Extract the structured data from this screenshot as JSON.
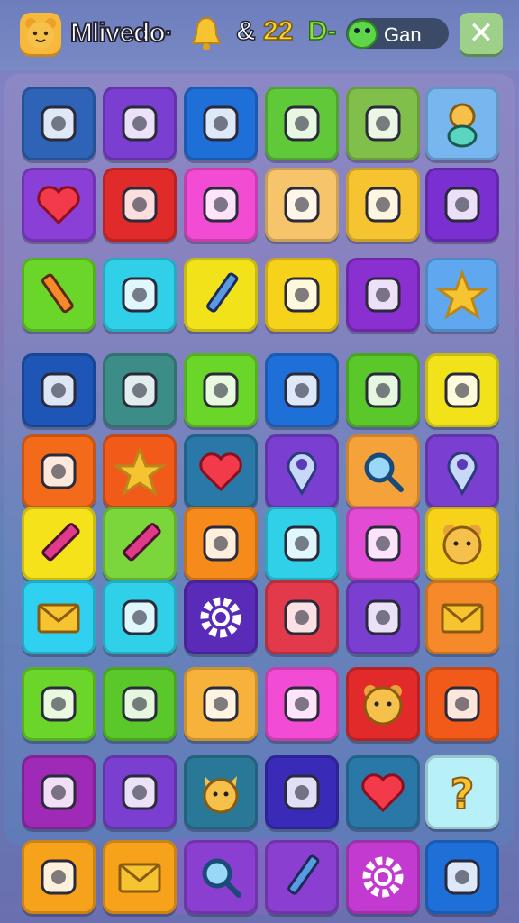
{
  "header": {
    "title": "Mlivedo·",
    "score_prefix": "&",
    "score_value": "22",
    "score_suffix": "D-",
    "player_label": "Gan",
    "close_label": "✕"
  },
  "colors": {
    "topbar": "#7484c2",
    "pill": "#3b4a66",
    "close_button": "#9ed08a"
  },
  "grid": {
    "rows": [
      [
        "portfolio-icon",
        "candy-stick-icon",
        "eye-icon",
        "chain-link-icon",
        "lipstick-icon",
        "teddy-bear-icon"
      ],
      [
        "heart-icon",
        "ice-pop-icon",
        "lollipop-icon",
        "ring-key-icon",
        "speech-bubble-icon",
        "dial-icon"
      ],
      [
        "pencil-icon",
        "tablet-icon",
        "pen-icon",
        "robot-toy-icon",
        "jar-icon",
        "star-icon"
      ],
      [
        "notepad-icon",
        "plane-icon",
        "dice-icon",
        "ice-cream-icon",
        "leaf-badge-icon",
        "balloon-face-icon"
      ],
      [
        "key-ring-icon",
        "star-icon",
        "heart-icon",
        "location-pin-icon",
        "magnifier-icon",
        "location-pin-icon"
      ],
      [
        "crayon-icon",
        "crayon-icon",
        "cone-icon",
        "ticket-icon",
        "leaf-icon",
        "bear-face-icon"
      ],
      [
        "envelope-icon",
        "lollipop-icon",
        "gear-icon",
        "shopping-bag-icon",
        "creature-icon",
        "envelope-icon"
      ],
      [
        "brush-icon",
        "balloon-icon",
        "hammer-icon",
        "spoon-icon",
        "bear-face-icon",
        "phone-icon"
      ],
      [
        "whistle-icon",
        "pinwheel-icon",
        "cat-face-icon",
        "eraser-icon",
        "heart-icon",
        "question-mark-icon"
      ],
      [
        "box-icon",
        "envelope-icon",
        "magnifier-icon",
        "pen-icon",
        "gear-icon",
        "sparkle-icon"
      ]
    ],
    "tile_colors": [
      [
        "#2e63b8",
        "#7a3fd0",
        "#1e6fd8",
        "#5fc93a",
        "#7fbf4a",
        "#78b6f0"
      ],
      [
        "#8a3fd6",
        "#e12a2a",
        "#f24bd4",
        "#f6c46a",
        "#f6c430",
        "#7a2fd0"
      ],
      [
        "#6ad62a",
        "#2fd0e8",
        "#f2e21a",
        "#f6d21a",
        "#8a2fd0",
        "#5fa8f0"
      ],
      [
        "#1e56b8",
        "#3c8c88",
        "#6ad62a",
        "#1e6fd8",
        "#5ac82a",
        "#f2e21a"
      ],
      [
        "#f26a1a",
        "#f25a1a",
        "#2a78a8",
        "#7a3fd0",
        "#f6a23a",
        "#7a3fd0"
      ],
      [
        "#f6e21a",
        "#7ad63a",
        "#f68a1a",
        "#2fd0e8",
        "#e24bd4",
        "#f6d21a"
      ],
      [
        "#2fd0f0",
        "#2fd0e8",
        "#5a2ab8",
        "#e23a4a",
        "#7a3fd0",
        "#f68a2a"
      ],
      [
        "#6ad62a",
        "#5ac82a",
        "#f6b23a",
        "#f24bd4",
        "#e22a2a",
        "#f25a1a"
      ],
      [
        "#a02ab8",
        "#7a3fd0",
        "#2a7898",
        "#3a2ab8",
        "#2a78a8",
        "#b8f0f8"
      ],
      [
        "#f6a21a",
        "#f6a21a",
        "#8a3fd0",
        "#8a3fd0",
        "#c23ad0",
        "#1e6fd8"
      ]
    ]
  }
}
